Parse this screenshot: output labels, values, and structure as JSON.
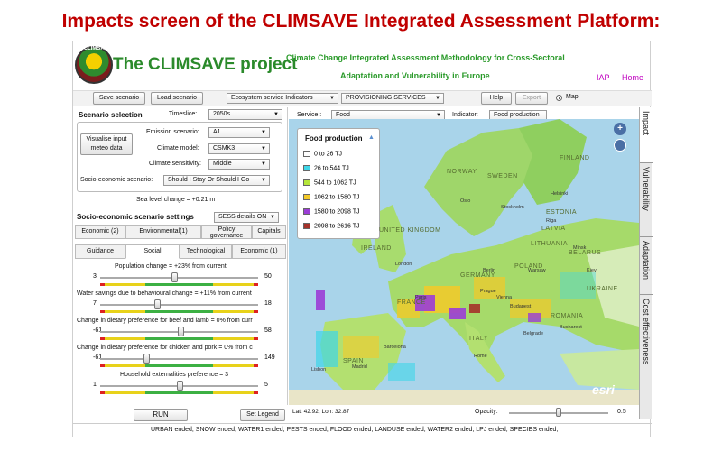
{
  "slide_title": "Impacts screen of the CLIMSAVE Integrated Assessment Platform:",
  "header": {
    "logo_text": "CLIMSAVE",
    "project_title": "The CLIMSAVE project",
    "subtitle_line1": "Climate Change Integrated Assessment Methodology for Cross-Sectoral",
    "subtitle_line2": "Adaptation and Vulnerability in Europe",
    "link_iap": "IAP",
    "link_home": "Home"
  },
  "toolbar": {
    "save_label": "Save scenario",
    "load_label": "Load scenario",
    "indicator_group": "Ecosystem service Indicators",
    "service_group": "PROVISIONING SERVICES",
    "help_label": "Help",
    "export_label": "Export",
    "map_label": "Map"
  },
  "scenario": {
    "heading": "Scenario selection",
    "timeslice_label": "Timeslice:",
    "timeslice_value": "2050s",
    "visualise_label": "Visualise input meteo data",
    "emission_label": "Emission scenario:",
    "emission_value": "A1",
    "climate_model_label": "Climate model:",
    "climate_model_value": "CSMK3",
    "sensitivity_label": "Climate sensitivity:",
    "sensitivity_value": "Middle",
    "socio_label": "Socio-economic scenario:",
    "socio_value": "Should I Stay Or Should I Go",
    "sea_level": "Sea level change = +0.21 m"
  },
  "settings": {
    "heading": "Socio-economic scenario settings",
    "sess_value": "SESS details ON",
    "tabs_row1": [
      "Economic (2)",
      "Environmental(1)",
      "Policy governance",
      "Capitals"
    ],
    "tabs_row2": [
      "Guidance",
      "Social",
      "Technological",
      "Economic (1)"
    ]
  },
  "sliders": [
    {
      "title": "Population change = +23% from current",
      "min": "3",
      "max": "50",
      "level": 0.47
    },
    {
      "title": "Water savings due to behavioural change = +11% from current",
      "min": "7",
      "max": "18",
      "level": 0.36
    },
    {
      "title": "Change in dietary preference for beef and lamb = 0% from curr",
      "min": "-61",
      "max": "58",
      "level": 0.51
    },
    {
      "title": "Change in dietary preference for chicken and pork = 0% from c",
      "min": "-61",
      "max": "149",
      "level": 0.29
    },
    {
      "title": "Household externalities preference = 3",
      "min": "1",
      "max": "5",
      "level": 0.5
    }
  ],
  "bottom_buttons": {
    "run_label": "RUN",
    "legend_label": "Set Legend"
  },
  "service": {
    "service_label": "Service :",
    "service_value": "Food",
    "indicator_label": "Indicator:",
    "indicator_value": "Food production"
  },
  "legend": {
    "title": "Food production",
    "items": [
      {
        "label": "0 to 26  TJ",
        "color": "#ffffff"
      },
      {
        "label": "26 to 544  TJ",
        "color": "#3fd6e8"
      },
      {
        "label": "544 to 1062  TJ",
        "color": "#b5e63a"
      },
      {
        "label": "1062 to 1580  TJ",
        "color": "#f3c928"
      },
      {
        "label": "1580 to 2098  TJ",
        "color": "#9b3dd6"
      },
      {
        "label": "2098 to 2616  TJ",
        "color": "#a5322a"
      }
    ]
  },
  "map": {
    "coords": "Lat: 42.92, Lon: 32.87",
    "opacity_label": "Opacity:",
    "opacity_value": "0.5",
    "opacity_level": 0.5,
    "esri_label": "esri",
    "place_labels": [
      "FINLAND",
      "NORWAY",
      "SWEDEN",
      "ESTONIA",
      "LATVIA",
      "LITHUANIA",
      "BELARUS",
      "POLAND",
      "UKRAINE",
      "GERMANY",
      "FRANCE",
      "SPAIN",
      "ITALY",
      "ROMANIA",
      "IRELAND",
      "UNITED KINGDOM",
      "Paris",
      "London",
      "Madrid",
      "Rome",
      "Warsaw",
      "Kiev",
      "Minsk",
      "Berlin",
      "Budapest",
      "Bucharest",
      "Belgrade",
      "Lisbon",
      "Barcelona",
      "Stockholm",
      "Oslo",
      "Helsinki",
      "Riga",
      "Prague",
      "Vienna"
    ]
  },
  "right_tabs": [
    "Impact",
    "Vulnerability",
    "Adaptation",
    "Cost effectiveness"
  ],
  "status": "URBAN ended; SNOW ended; WATER1 ended; PESTS ended; FLOOD ended; LANDUSE ended; WATER2 ended; LPJ ended; SPECIES ended;"
}
